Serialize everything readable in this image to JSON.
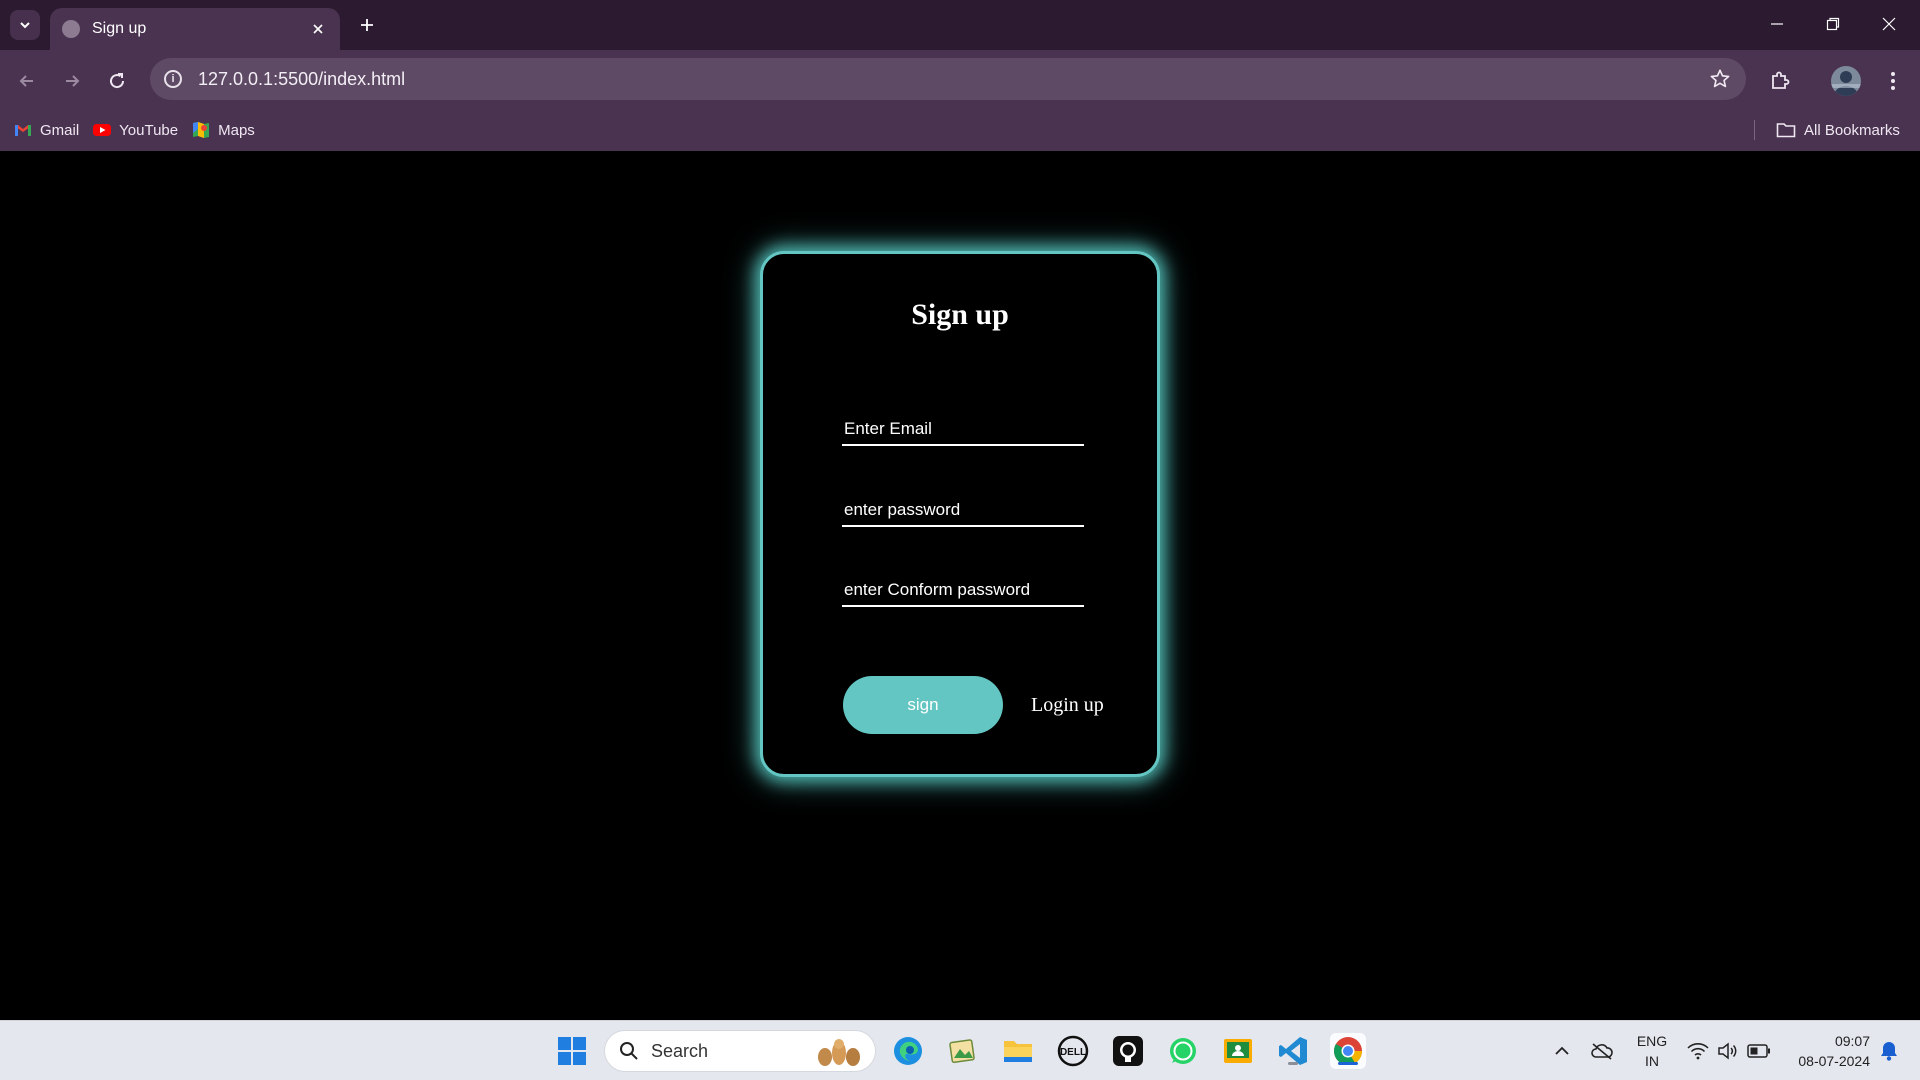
{
  "browser": {
    "tab_title": "Sign up",
    "url": "127.0.0.1:5500/index.html",
    "bookmarks": [
      {
        "label": "Gmail",
        "icon": "gmail-icon"
      },
      {
        "label": "YouTube",
        "icon": "youtube-icon"
      },
      {
        "label": "Maps",
        "icon": "maps-icon"
      }
    ],
    "all_bookmarks": "All Bookmarks"
  },
  "signup": {
    "title": "Sign up",
    "email_placeholder": "Enter Email",
    "password_placeholder": "enter password",
    "confirm_placeholder": "enter Conform password",
    "sign_label": "sign",
    "login_label": "Login up"
  },
  "taskbar": {
    "search_label": "Search",
    "lang_top": "ENG",
    "lang_bottom": "IN",
    "time": "09:07",
    "date": "08-07-2024"
  },
  "colors": {
    "accent": "#63c6c2",
    "browser_frame": "#2b1a30",
    "toolbar": "#4a3350"
  }
}
